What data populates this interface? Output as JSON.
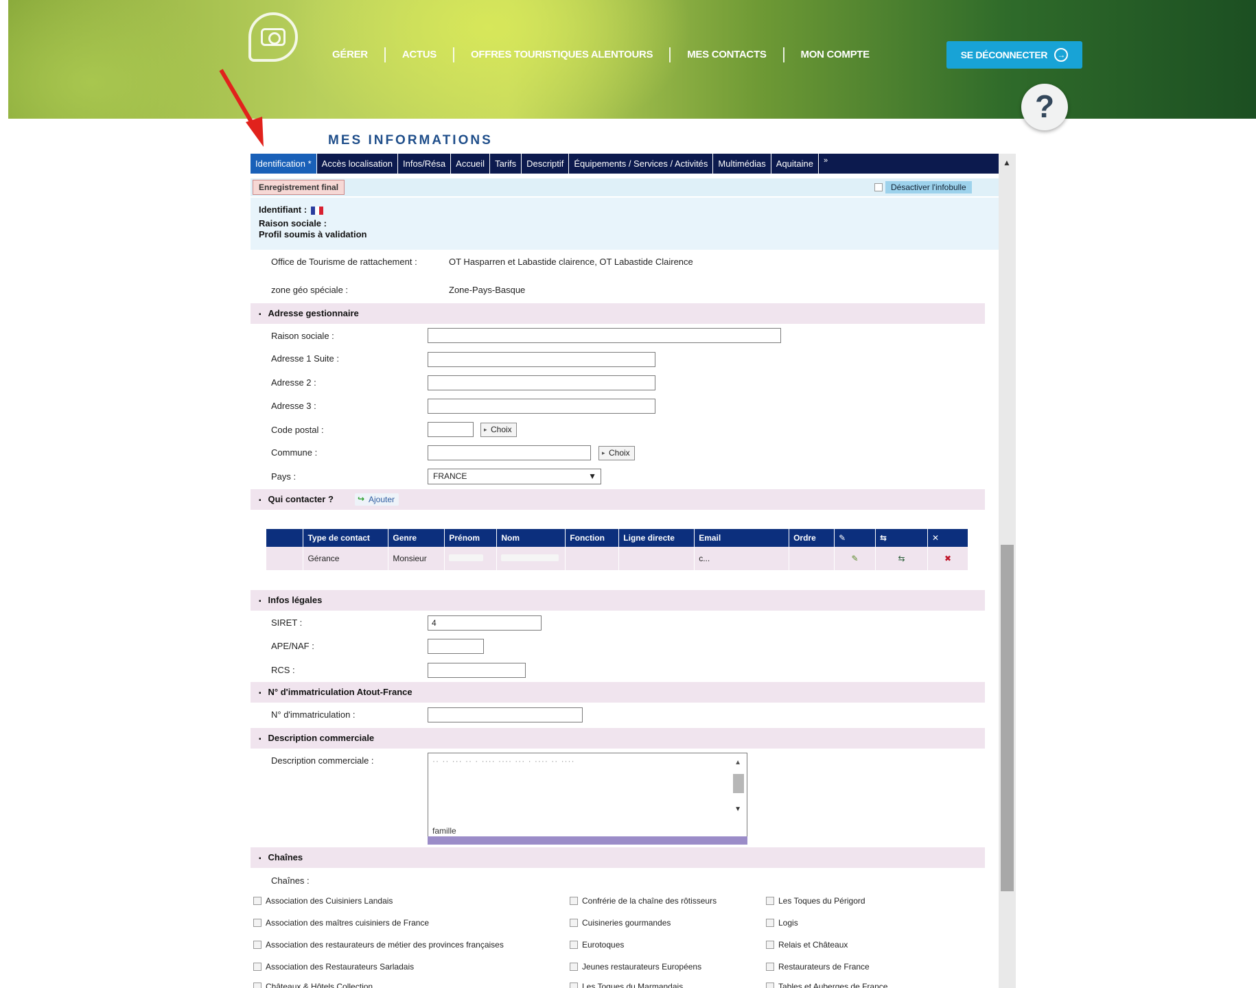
{
  "header": {
    "nav": [
      "GÉRER",
      "ACTUS",
      "OFFRES TOURISTIQUES ALENTOURS",
      "MES CONTACTS",
      "MON COMPTE"
    ],
    "logout_label": "SE DÉCONNECTER",
    "help_label": "?"
  },
  "page_title": "MES INFORMATIONS",
  "tabs": [
    "Identification *",
    "Accès localisation",
    "Infos/Résa",
    "Accueil",
    "Tarifs",
    "Descriptif",
    "Équipements / Services / Activités",
    "Multimédias",
    "Aquitaine",
    "»"
  ],
  "final_button": "Enregistrement final",
  "infobulle_label": "Désactiver l'infobulle",
  "identity": {
    "identifiant_label": "Identifiant :",
    "raison_label": "Raison sociale :",
    "profil_label": "Profil soumis à validation"
  },
  "office": {
    "label": "Office de Tourisme de rattachement :",
    "value": "OT Hasparren et Labastide clairence, OT Labastide Clairence"
  },
  "zone": {
    "label": "zone géo spéciale :",
    "value": "Zone-Pays-Basque"
  },
  "sections": {
    "adresse": "Adresse gestionnaire",
    "contact": "Qui contacter ?",
    "legal": "Infos légales",
    "atout": "N° d'immatriculation Atout-France",
    "desc": "Description commerciale",
    "chaines": "Chaînes"
  },
  "address": {
    "raison": "Raison sociale :",
    "adr1": "Adresse 1 Suite :",
    "adr2": "Adresse 2 :",
    "adr3": "Adresse 3 :",
    "cp": "Code postal :",
    "commune": "Commune :",
    "pays": "Pays :",
    "pays_value": "FRANCE",
    "choix": "Choix"
  },
  "ajouter_label": "Ajouter",
  "contacts": {
    "headers": [
      "Type de contact",
      "Genre",
      "Prénom",
      "Nom",
      "Fonction",
      "Ligne directe",
      "Email",
      "Ordre"
    ],
    "row": {
      "type": "Gérance",
      "genre": "Monsieur",
      "email": "c..."
    }
  },
  "legal": {
    "siret": "SIRET :",
    "siret_value": "4",
    "ape": "APE/NAF :",
    "rcs": "RCS :"
  },
  "atout_label": "N° d'immatriculation :",
  "desc_label": "Description commerciale :",
  "desc_last": "famille",
  "chains_label": "Chaînes :",
  "chains": [
    [
      "Association des Cuisiniers Landais",
      "Confrérie de la chaîne des rôtisseurs",
      "Les Toques du Périgord"
    ],
    [
      "Association des maîtres cuisiniers de France",
      "Cuisineries gourmandes",
      "Logis"
    ],
    [
      "Association des restaurateurs de métier des provinces françaises",
      "Eurotoques",
      "Relais et Châteaux"
    ],
    [
      "Association des Restaurateurs Sarladais",
      "Jeunes restaurateurs Européens",
      "Restaurateurs de France"
    ],
    [
      "Châteaux & Hôtels Collection",
      "Les Toques du Marmandais",
      "Tables et Auberges de France"
    ]
  ]
}
